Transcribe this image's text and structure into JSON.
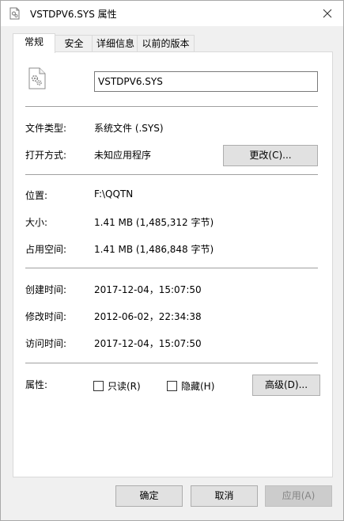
{
  "window": {
    "title": "VSTDPV6.SYS 属性"
  },
  "tabs": [
    {
      "label": "常规"
    },
    {
      "label": "安全"
    },
    {
      "label": "详细信息"
    },
    {
      "label": "以前的版本"
    }
  ],
  "general": {
    "filename": "VSTDPV6.SYS",
    "file_type_label": "文件类型:",
    "file_type_value": "系统文件 (.SYS)",
    "opens_with_label": "打开方式:",
    "opens_with_value": "未知应用程序",
    "change_button": "更改(C)...",
    "location_label": "位置:",
    "location_value": "F:\\QQTN",
    "size_label": "大小:",
    "size_value": "1.41 MB (1,485,312 字节)",
    "size_on_disk_label": "占用空间:",
    "size_on_disk_value": "1.41 MB (1,486,848 字节)",
    "created_label": "创建时间:",
    "created_value": "2017-12-04，15:07:50",
    "modified_label": "修改时间:",
    "modified_value": "2012-06-02，22:34:38",
    "accessed_label": "访问时间:",
    "accessed_value": "2017-12-04，15:07:50",
    "attributes_label": "属性:",
    "readonly_label": "只读(R)",
    "readonly_checked": false,
    "hidden_label": "隐藏(H)",
    "hidden_checked": false,
    "advanced_button": "高级(D)..."
  },
  "footer": {
    "ok_button": "确定",
    "cancel_button": "取消",
    "apply_button": "应用(A)"
  },
  "icons": {
    "title": "system-file-icon",
    "close": "close-icon",
    "file": "system-file-icon"
  }
}
